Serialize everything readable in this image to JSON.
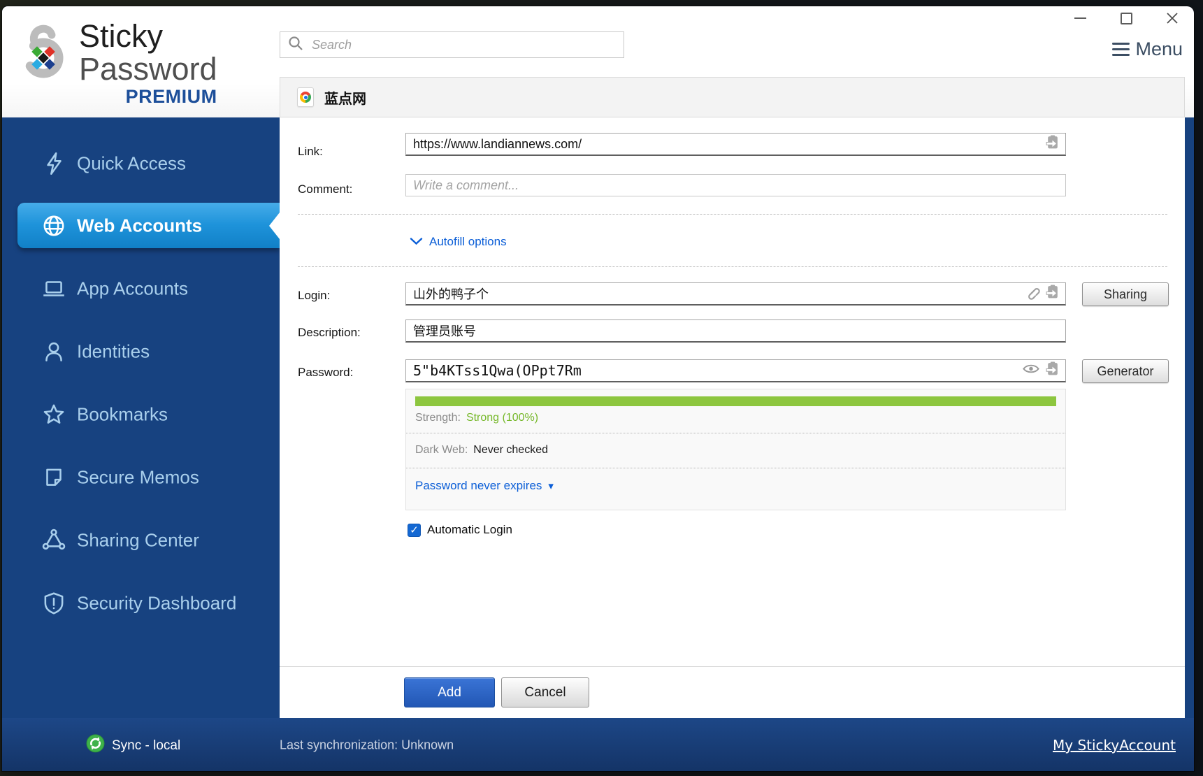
{
  "header": {
    "logo": {
      "line1": "Sticky",
      "line2": "Password",
      "badge": "PREMIUM"
    },
    "search": {
      "placeholder": "Search"
    },
    "menu_label": "Menu"
  },
  "sidebar": {
    "items": [
      {
        "id": "quick-access",
        "label": "Quick Access",
        "icon": "lightning-icon",
        "selected": false
      },
      {
        "id": "web-accounts",
        "label": "Web Accounts",
        "icon": "globe-icon",
        "selected": true
      },
      {
        "id": "app-accounts",
        "label": "App Accounts",
        "icon": "laptop-icon",
        "selected": false
      },
      {
        "id": "identities",
        "label": "Identities",
        "icon": "person-icon",
        "selected": false
      },
      {
        "id": "bookmarks",
        "label": "Bookmarks",
        "icon": "star-icon",
        "selected": false
      },
      {
        "id": "secure-memos",
        "label": "Secure Memos",
        "icon": "memo-icon",
        "selected": false
      },
      {
        "id": "sharing-center",
        "label": "Sharing Center",
        "icon": "share-icon",
        "selected": false
      },
      {
        "id": "security-dashboard",
        "label": "Security Dashboard",
        "icon": "shield-icon",
        "selected": false
      }
    ]
  },
  "account_form": {
    "title": "蓝点网",
    "title_icon": "chrome-favicon-icon",
    "fields": {
      "link": {
        "label": "Link:",
        "value": "https://www.landiannews.com/"
      },
      "comment": {
        "label": "Comment:",
        "placeholder": "Write a comment..."
      },
      "login": {
        "label": "Login:",
        "value": "山外的鸭子个"
      },
      "description": {
        "label": "Description:",
        "value": "管理员账号"
      },
      "password": {
        "label": "Password:",
        "value": "5\"b4KTss1Qwa(OPpt7Rm"
      }
    },
    "autofill_link": "Autofill options",
    "strength": {
      "label": "Strength:",
      "value": "Strong (100%)",
      "percent": 100,
      "bar_color": "#8dc63f"
    },
    "dark_web": {
      "label": "Dark Web:",
      "value": "Never checked"
    },
    "expires_link": "Password never expires",
    "automatic_login": {
      "label": "Automatic Login",
      "checked": true
    },
    "buttons": {
      "sharing": "Sharing",
      "generator": "Generator",
      "add": "Add",
      "cancel": "Cancel"
    }
  },
  "footer": {
    "sync_label": "Sync - local",
    "last_sync": "Last synchronization: Unknown",
    "account_link": "My StickyAccount"
  },
  "glyphs": {
    "caret_down": "▾",
    "check": "✓"
  },
  "colors": {
    "sidebar_navy": "#174280",
    "selected_item_blue": "#1e93da",
    "accent_link_blue": "#0b5ed7",
    "strength_green": "#8dc63f",
    "add_button_blue": "#2b64c6",
    "sync_green": "#3eb24a"
  }
}
